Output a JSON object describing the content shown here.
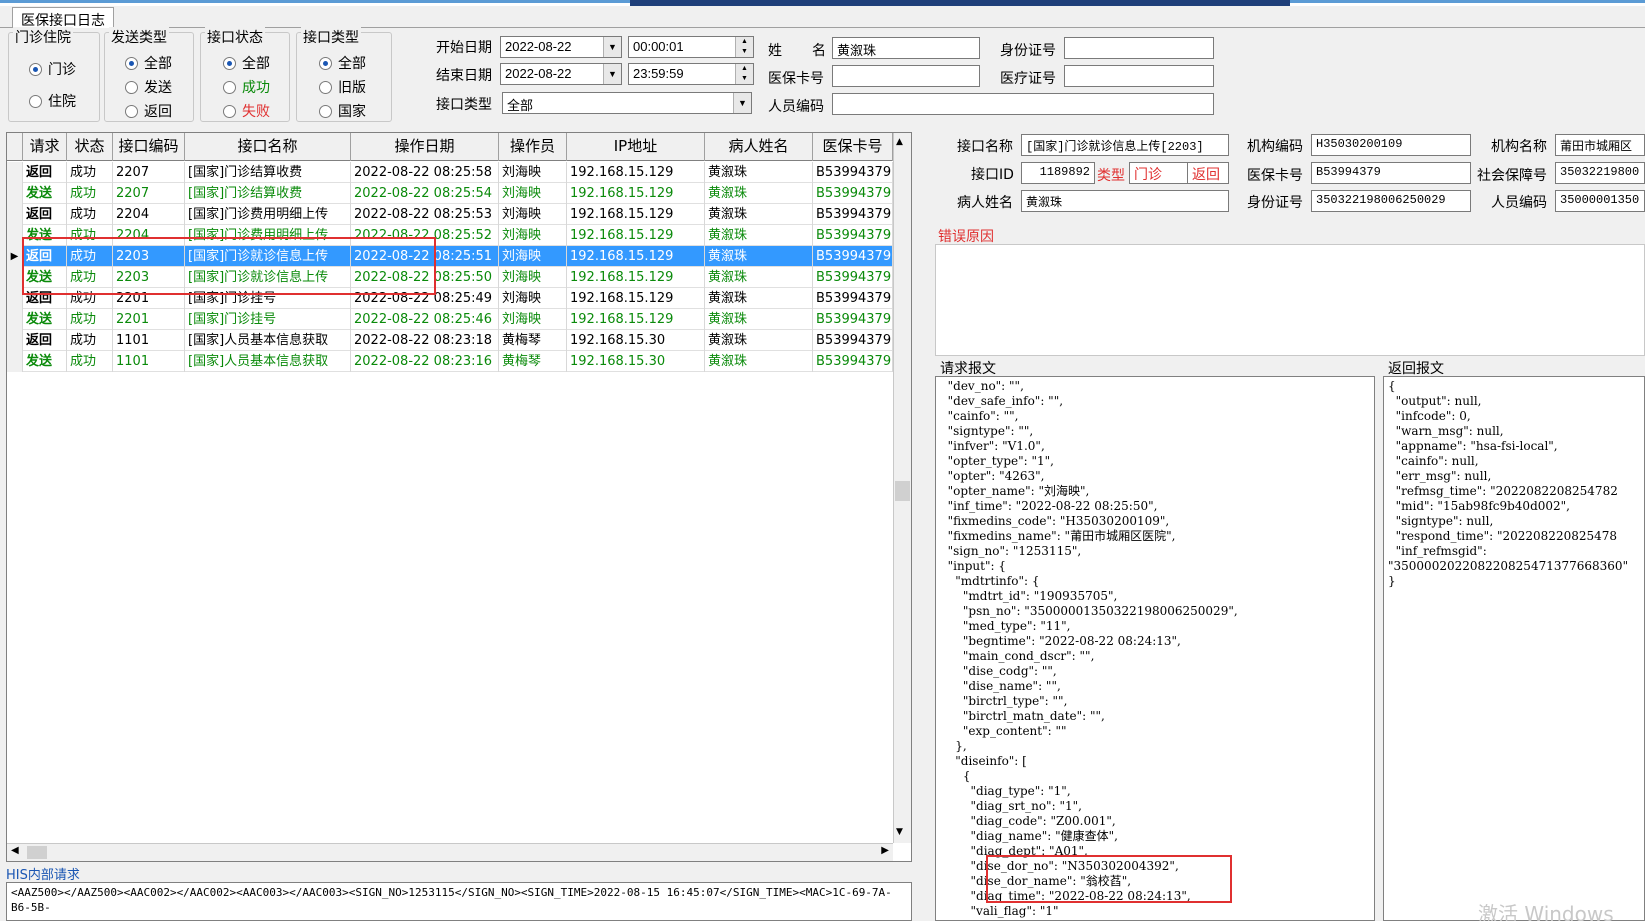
{
  "window": {
    "tab_title": "医保接口日志"
  },
  "filters": {
    "visit_group": {
      "title": "门诊住院",
      "options": [
        "门诊",
        "住院"
      ],
      "selected": 0
    },
    "send_group": {
      "title": "发送类型",
      "options": [
        "全部",
        "发送",
        "返回"
      ],
      "selected": 0
    },
    "status_group": {
      "title": "接口状态",
      "options": [
        "全部",
        "成功",
        "失败"
      ],
      "selected": 0
    },
    "type_group": {
      "title": "接口类型",
      "options": [
        "全部",
        "旧版",
        "国家"
      ],
      "selected": 0
    },
    "start_date_label": "开始日期",
    "start_date": "2022-08-22",
    "start_time": "00:00:01",
    "end_date_label": "结束日期",
    "end_date": "2022-08-22",
    "end_time": "23:59:59",
    "iface_type_label": "接口类型",
    "iface_type_value": "全部",
    "name_label_1": "姓",
    "name_label_2": "名",
    "name_value": "黄溆珠",
    "card_label": "医保卡号",
    "card_value": "",
    "person_code_label": "人员编码",
    "person_code_value": "",
    "id_label": "身份证号",
    "id_value": "",
    "medcert_label": "医疗证号",
    "medcert_value": ""
  },
  "grid": {
    "columns": [
      "请求",
      "状态",
      "接口编码",
      "接口名称",
      "操作日期",
      "操作员",
      "IP地址",
      "病人姓名",
      "医保卡号"
    ],
    "rows": [
      {
        "req": "返回",
        "status": "成功",
        "code": "2207",
        "name": "[国家]门诊结算收费",
        "date": "2022-08-22 08:25:58",
        "op": "刘海映",
        "ip": "192.168.15.129",
        "patient": "黄溆珠",
        "card": "B53994379",
        "style": "normal"
      },
      {
        "req": "发送",
        "status": "成功",
        "code": "2207",
        "name": "[国家]门诊结算收费",
        "date": "2022-08-22 08:25:54",
        "op": "刘海映",
        "ip": "192.168.15.129",
        "patient": "黄溆珠",
        "card": "B53994379",
        "style": "green"
      },
      {
        "req": "返回",
        "status": "成功",
        "code": "2204",
        "name": "[国家]门诊费用明细上传",
        "date": "2022-08-22 08:25:53",
        "op": "刘海映",
        "ip": "192.168.15.129",
        "patient": "黄溆珠",
        "card": "B53994379",
        "style": "normal"
      },
      {
        "req": "发送",
        "status": "成功",
        "code": "2204",
        "name": "[国家]门诊费用明细上传",
        "date": "2022-08-22 08:25:52",
        "op": "刘海映",
        "ip": "192.168.15.129",
        "patient": "黄溆珠",
        "card": "B53994379",
        "style": "green"
      },
      {
        "req": "返回",
        "status": "成功",
        "code": "2203",
        "name": "[国家]门诊就诊信息上传",
        "date": "2022-08-22 08:25:51",
        "op": "刘海映",
        "ip": "192.168.15.129",
        "patient": "黄溆珠",
        "card": "B53994379",
        "style": "sel"
      },
      {
        "req": "发送",
        "status": "成功",
        "code": "2203",
        "name": "[国家]门诊就诊信息上传",
        "date": "2022-08-22 08:25:50",
        "op": "刘海映",
        "ip": "192.168.15.129",
        "patient": "黄溆珠",
        "card": "B53994379",
        "style": "green"
      },
      {
        "req": "返回",
        "status": "成功",
        "code": "2201",
        "name": "[国家]门诊挂号",
        "date": "2022-08-22 08:25:49",
        "op": "刘海映",
        "ip": "192.168.15.129",
        "patient": "黄溆珠",
        "card": "B53994379",
        "style": "normal"
      },
      {
        "req": "发送",
        "status": "成功",
        "code": "2201",
        "name": "[国家]门诊挂号",
        "date": "2022-08-22 08:25:46",
        "op": "刘海映",
        "ip": "192.168.15.129",
        "patient": "黄溆珠",
        "card": "B53994379",
        "style": "green"
      },
      {
        "req": "返回",
        "status": "成功",
        "code": "1101",
        "name": "[国家]人员基本信息获取",
        "date": "2022-08-22 08:23:18",
        "op": "黄梅琴",
        "ip": "192.168.15.30",
        "patient": "黄溆珠",
        "card": "B53994379",
        "style": "normal"
      },
      {
        "req": "发送",
        "status": "成功",
        "code": "1101",
        "name": "[国家]人员基本信息获取",
        "date": "2022-08-22 08:23:16",
        "op": "黄梅琴",
        "ip": "192.168.15.30",
        "patient": "黄溆珠",
        "card": "B53994379",
        "style": "green"
      }
    ]
  },
  "his": {
    "title": "HIS内部请求",
    "text": "<AAZ500></AAZ500><AAC002></AAC002><AAC003></AAC003><SIGN_NO>1253115</SIGN_NO><SIGN_TIME>2022-08-15 16:45:07</SIGN_TIME><MAC>1C-69-7A-B6-5B-"
  },
  "detail": {
    "iface_name_label": "接口名称",
    "iface_name": "[国家]门诊就诊信息上传[2203]",
    "org_code_label": "机构编码",
    "org_code": "H35030200109",
    "org_name_label": "机构名称",
    "org_name": "莆田市城厢区",
    "iface_id_label": "接口ID",
    "iface_id": "1189892",
    "type_label": "类型",
    "type_value": "门诊",
    "dir_value": "返回",
    "card_label": "医保卡号",
    "card_value": "B53994379",
    "ss_label": "社会保障号",
    "ss_value": "35032219800",
    "patient_label": "病人姓名",
    "patient_value": "黄溆珠",
    "idno_label": "身份证号",
    "idno_value": "350322198006250029",
    "person_label": "人员编码",
    "person_value": "35000001350",
    "error_title": "错误原因"
  },
  "request": {
    "title": "请求报文",
    "lines": [
      "  \"dev_no\": \"\",",
      "  \"dev_safe_info\": \"\",",
      "  \"cainfo\": \"\",",
      "  \"signtype\": \"\",",
      "  \"infver\": \"V1.0\",",
      "  \"opter_type\": \"1\",",
      "  \"opter\": \"4263\",",
      "  \"opter_name\": \"刘海映\",",
      "  \"inf_time\": \"2022-08-22 08:25:50\",",
      "  \"fixmedins_code\": \"H35030200109\",",
      "  \"fixmedins_name\": \"莆田市城厢区医院\",",
      "  \"sign_no\": \"1253115\",",
      "  \"input\": {",
      "    \"mdtrtinfo\": {",
      "      \"mdtrt_id\": \"190935705\",",
      "      \"psn_no\": \"35000001350322198006250029\",",
      "      \"med_type\": \"11\",",
      "      \"begntime\": \"2022-08-22 08:24:13\",",
      "      \"main_cond_dscr\": \"\",",
      "      \"dise_codg\": \"\",",
      "      \"dise_name\": \"\",",
      "      \"birctrl_type\": \"\",",
      "      \"birctrl_matn_date\": \"\",",
      "      \"exp_content\": \"\"",
      "    },",
      "    \"diseinfo\": [",
      "      {",
      "        \"diag_type\": \"1\",",
      "        \"diag_srt_no\": \"1\",",
      "        \"diag_code\": \"Z00.001\",",
      "        \"diag_name\": \"健康查体\",",
      "        \"diag_dept\": \"A01\",",
      "        \"dise_dor_no\": \"N350302004392\",",
      "        \"dise_dor_name\": \"翁校萏\",",
      "        \"diag_time\": \"2022-08-22 08:24:13\",",
      "        \"vali_flag\": \"1\""
    ]
  },
  "response": {
    "title": "返回报文",
    "lines": [
      "{",
      "  \"output\": null,",
      "  \"infcode\": 0,",
      "  \"warn_msg\": null,",
      "  \"appname\": \"hsa-fsi-local\",",
      "  \"cainfo\": null,",
      "  \"err_msg\": null,",
      "  \"refmsg_time\": \"2022082208254782",
      "  \"mid\": \"15ab98fc9b40d002\",",
      "  \"signtype\": null,",
      "  \"respond_time\": \"202208220825478",
      "  \"inf_refmsgid\":",
      "\"350000202208220825471377668360\"",
      "}"
    ]
  },
  "watermark": "激活 Windows"
}
